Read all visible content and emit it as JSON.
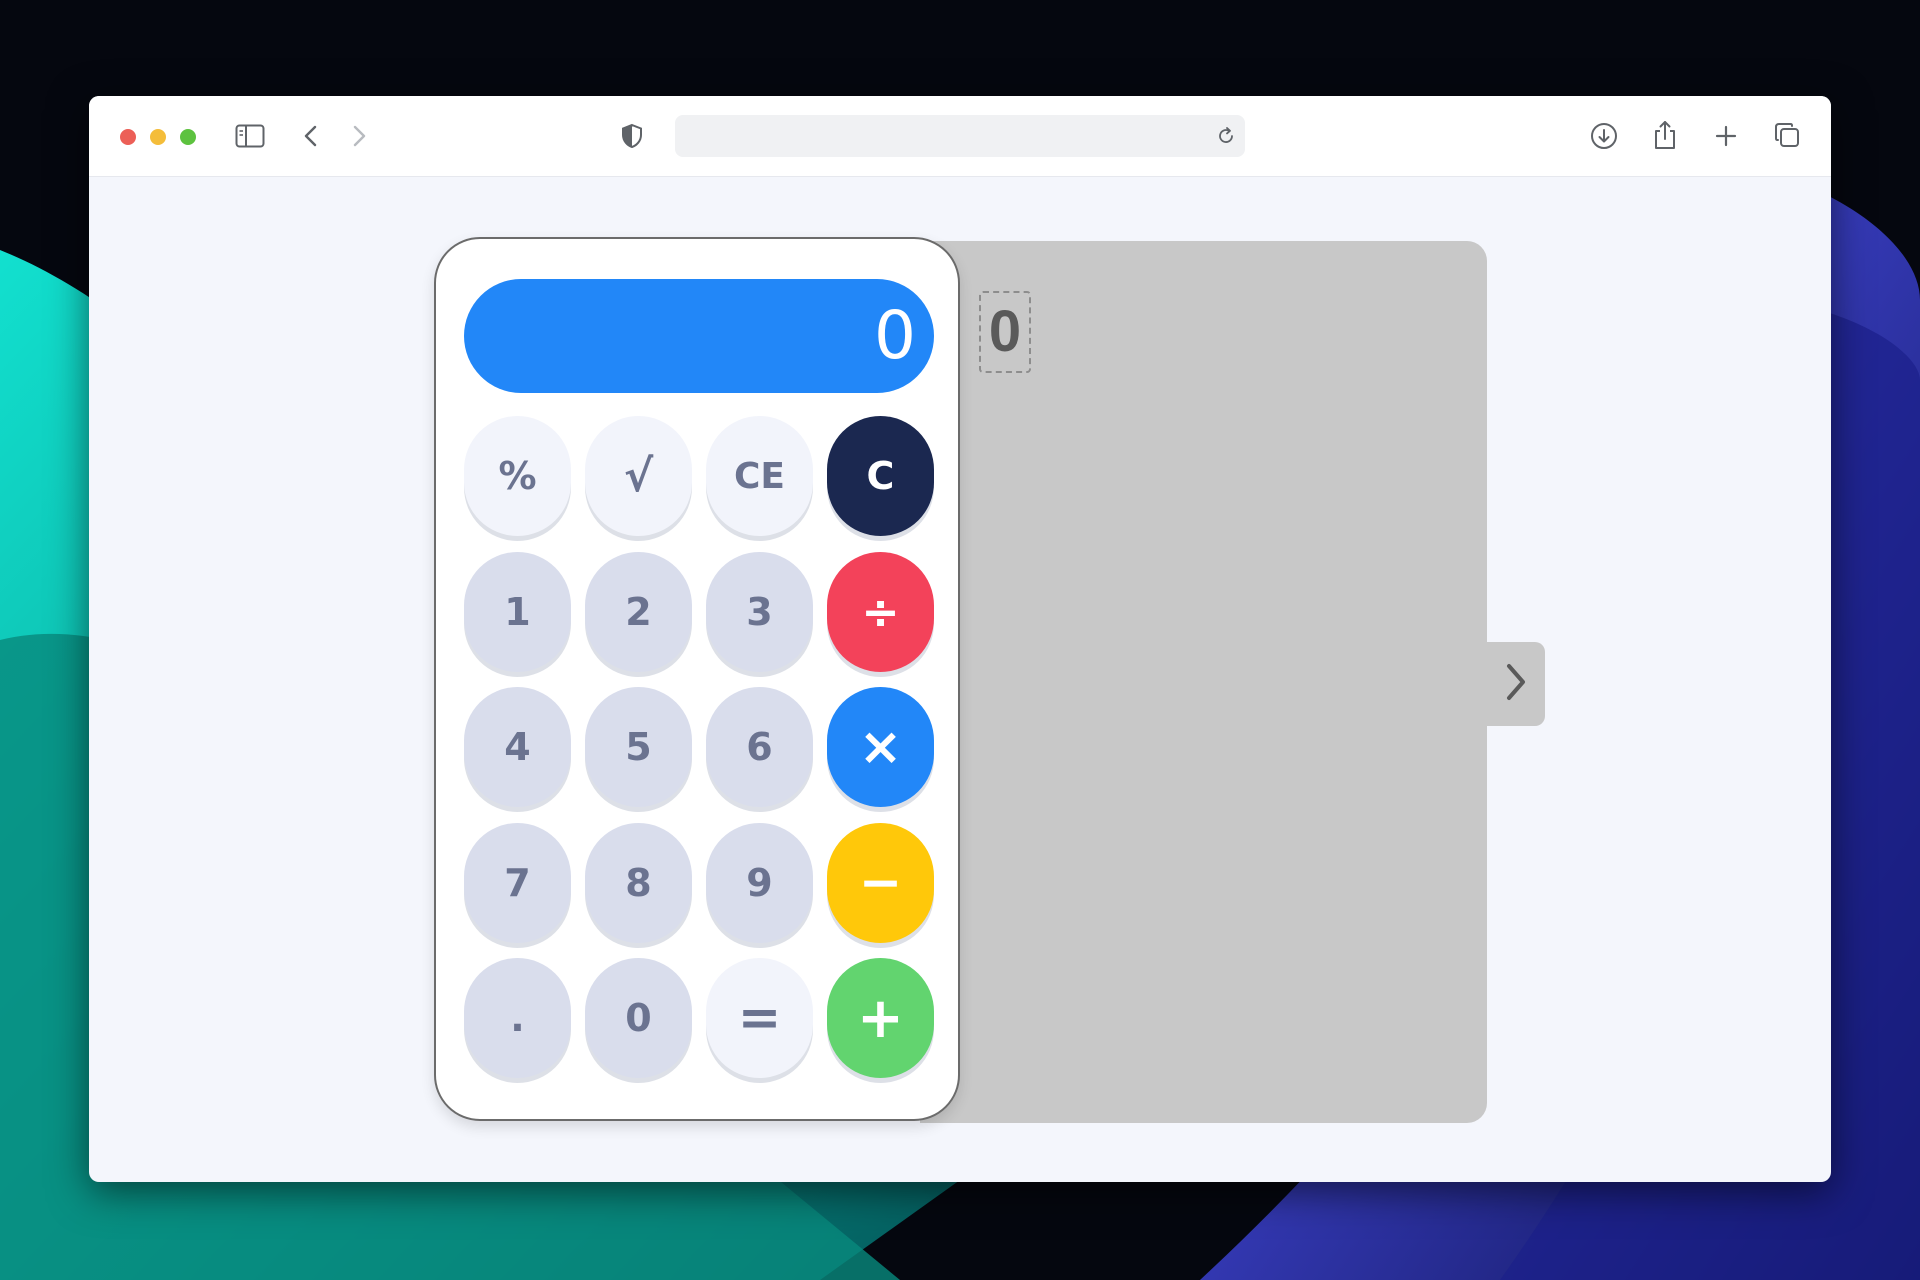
{
  "browser": {
    "address_text": "",
    "toolbar_icons": [
      "sidebar-icon",
      "back-icon",
      "forward-icon",
      "shield-icon",
      "reload-icon",
      "download-icon",
      "share-icon",
      "new-tab-icon",
      "tabs-overview-icon"
    ]
  },
  "calculator": {
    "display_value": "0",
    "keys": {
      "percent": "%",
      "sqrt": "√",
      "ce": "CE",
      "clear": "C",
      "one": "1",
      "two": "2",
      "three": "3",
      "divide": "÷",
      "four": "4",
      "five": "5",
      "six": "6",
      "multiply": "×",
      "seven": "7",
      "eight": "8",
      "nine": "9",
      "subtract": "−",
      "decimal": ".",
      "zero": "0",
      "equals": "=",
      "add": "+"
    },
    "colors": {
      "display": "#2287f8",
      "clear": "#1b2850",
      "divide": "#f3425a",
      "multiply": "#2287f8",
      "subtract": "#ffc80a",
      "add": "#62d46f",
      "number_key": "#d9ddec",
      "function_key": "#f2f4fb"
    }
  },
  "side_panel": {
    "mirror_value": "0",
    "expand_icon": "chevron-right-icon"
  }
}
